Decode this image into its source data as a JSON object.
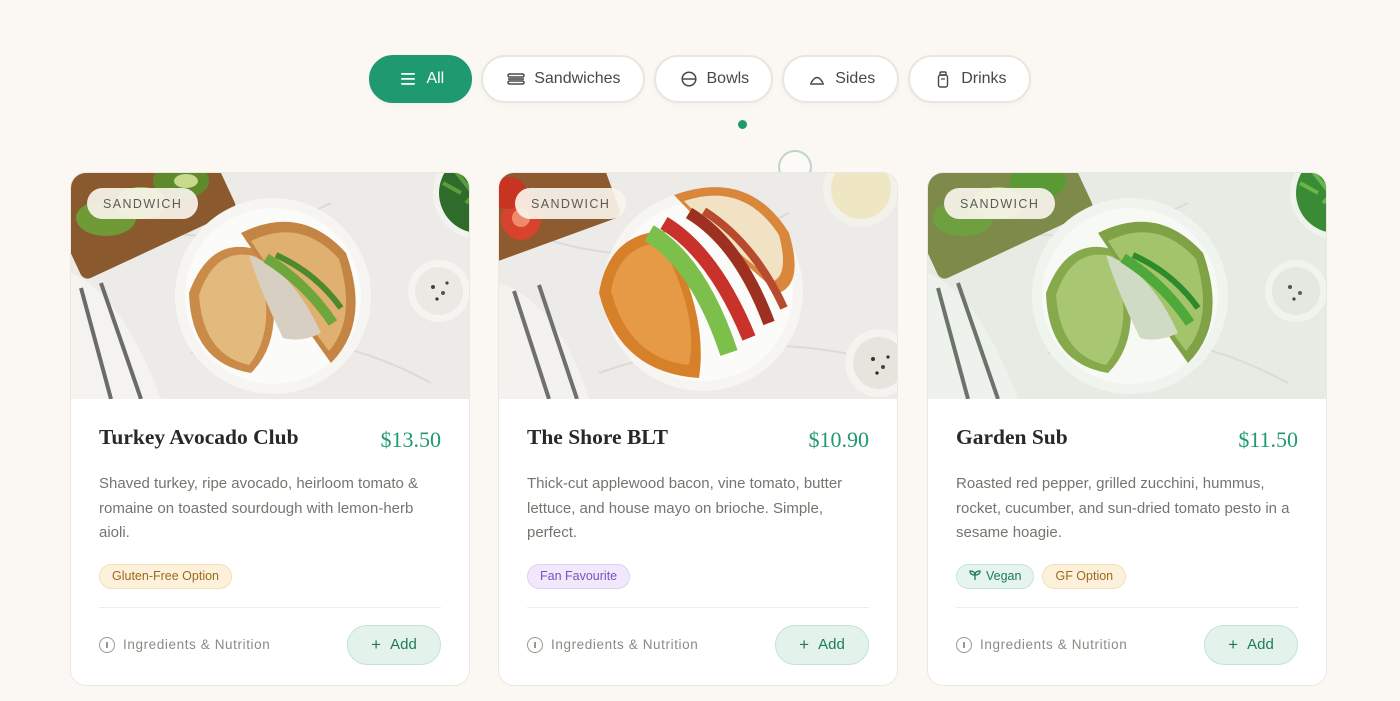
{
  "filters": {
    "tabs": [
      {
        "label": "All",
        "icon": "list-icon",
        "active": true
      },
      {
        "label": "Sandwiches",
        "icon": "sandwich-icon",
        "active": false
      },
      {
        "label": "Bowls",
        "icon": "bowl-icon",
        "active": false
      },
      {
        "label": "Sides",
        "icon": "side-dish-icon",
        "active": false
      },
      {
        "label": "Drinks",
        "icon": "drink-icon",
        "active": false
      }
    ]
  },
  "theme": {
    "accent": "#1f9a70",
    "background": "#fbf8f3"
  },
  "cards": [
    {
      "badge": "SANDWICH",
      "title": "Turkey Avocado Club",
      "price": "$13.50",
      "description": "Shaved turkey, ripe avocado, heirloom tomato & romaine on toasted sourdough with lemon-herb aioli.",
      "tags": [
        "Gluten-Free Option"
      ],
      "info_label": "Ingredients & Nutrition",
      "add_label": "Add"
    },
    {
      "badge": "SANDWICH",
      "title": "The Shore BLT",
      "price": "$10.90",
      "description": "Thick-cut applewood bacon, vine tomato, butter lettuce, and house mayo on brioche. Simple, perfect.",
      "tags": [
        "Fan Favourite"
      ],
      "info_label": "Ingredients & Nutrition",
      "add_label": "Add"
    },
    {
      "badge": "SANDWICH",
      "title": "Garden Sub",
      "price": "$11.50",
      "description": "Roasted red pepper, grilled zucchini, hummus, rocket, cucumber, and sun-dried tomato pesto in a sesame hoagie.",
      "tags": [
        "Vegan",
        "GF Option"
      ],
      "info_label": "Ingredients & Nutrition",
      "add_label": "Add"
    }
  ]
}
